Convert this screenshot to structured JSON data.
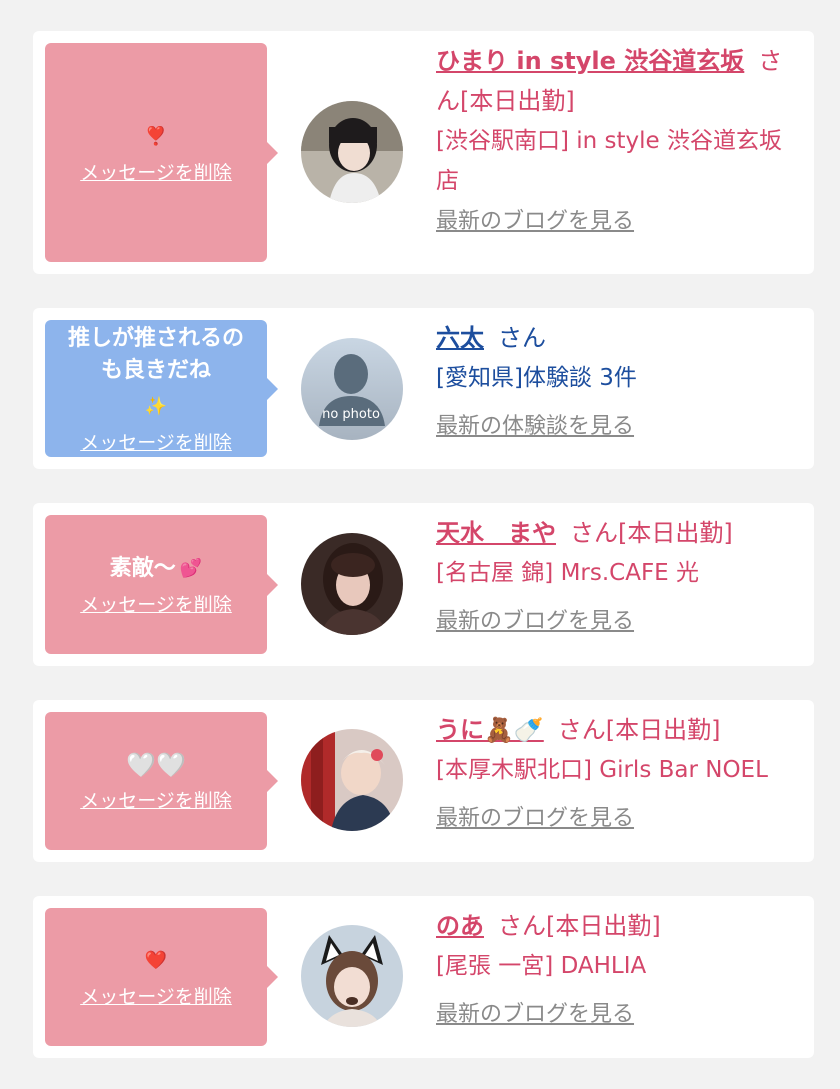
{
  "items": [
    {
      "message": "",
      "message_emoji": "❣️",
      "delete_label": "メッセージを削除",
      "name": "ひまり in style 渋谷道玄坂",
      "suffix": "さん[本日出勤]",
      "shop": "[渋谷駅南口] in style 渋谷道玄坂店",
      "link": "最新のブログを見る",
      "bubble_color": "#ec9ba6",
      "name_color": "#d4466a"
    },
    {
      "message": "推しが推されるのも良きだね",
      "message_emoji": "✨",
      "delete_label": "メッセージを削除",
      "name": "六太",
      "suffix": "さん",
      "shop": "[愛知県]体験談 3件",
      "link": "最新の体験談を見る",
      "bubble_color": "#8db4ec",
      "name_color": "#1d4e9e",
      "avatar_text": "no photo"
    },
    {
      "message": "素敵〜",
      "message_emoji": "💕",
      "delete_label": "メッセージを削除",
      "name": "天水　まや",
      "suffix": "さん[本日出勤]",
      "shop": "[名古屋 錦] Mrs.CAFE 光",
      "link": "最新のブログを見る",
      "bubble_color": "#ec9ba6",
      "name_color": "#d4466a"
    },
    {
      "message": "",
      "message_emoji": "🤍🤍",
      "delete_label": "メッセージを削除",
      "name": "うに🧸🍼",
      "suffix": "さん[本日出勤]",
      "shop": "[本厚木駅北口] Girls Bar NOEL",
      "link": "最新のブログを見る",
      "bubble_color": "#ec9ba6",
      "name_color": "#d4466a"
    },
    {
      "message": "",
      "message_emoji": "❤️",
      "delete_label": "メッセージを削除",
      "name": "のあ",
      "suffix": "さん[本日出勤]",
      "shop": "[尾張 一宮] DAHLIA",
      "link": "最新のブログを見る",
      "bubble_color": "#ec9ba6",
      "name_color": "#d4466a"
    }
  ]
}
